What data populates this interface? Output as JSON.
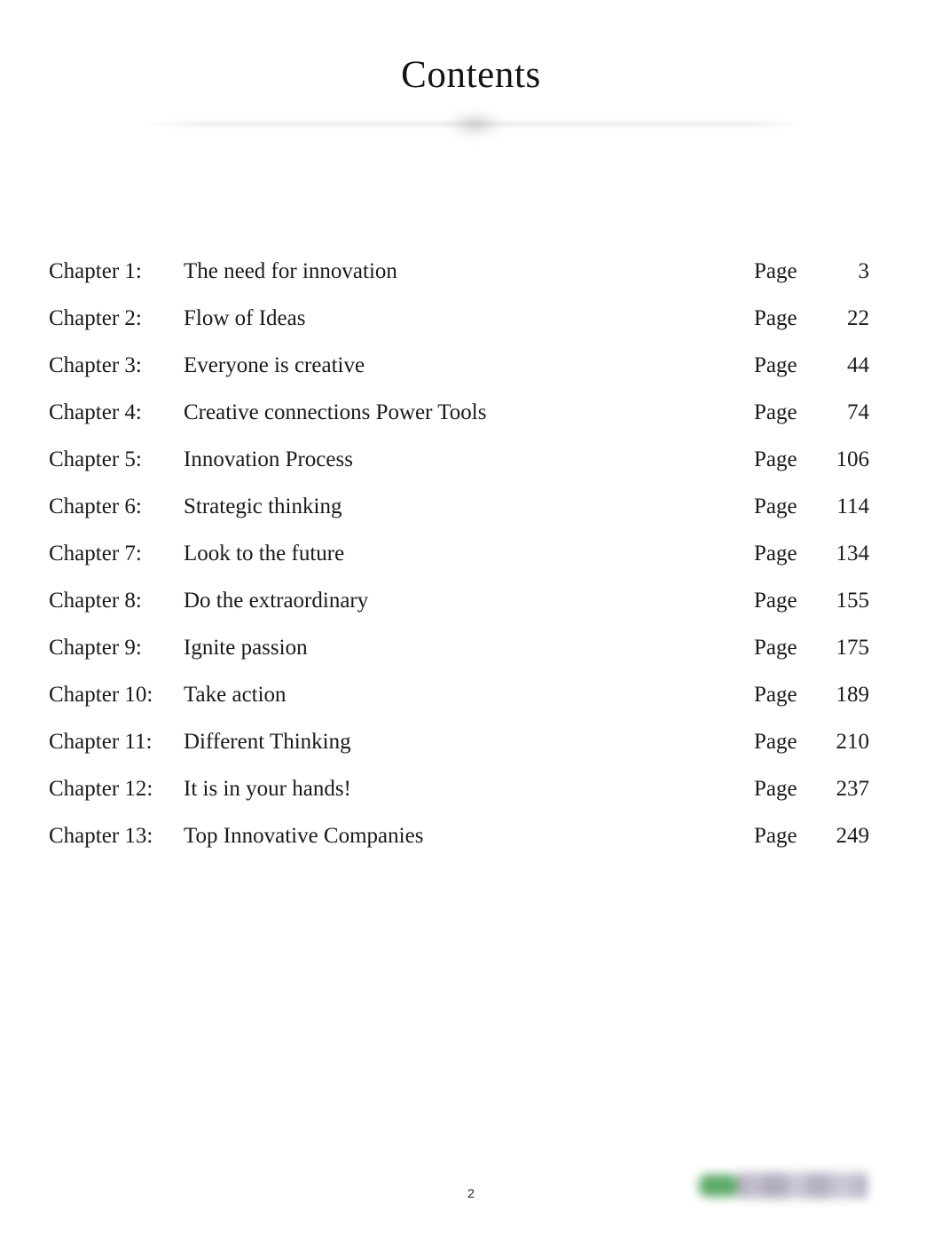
{
  "document": {
    "title": "Contents",
    "folio": "2",
    "text_color": "#1a1a1a",
    "background_color": "#ffffff"
  },
  "divider": {
    "ornament_icon": "flourish-ornament-icon",
    "rule_color": "#dcdce0"
  },
  "toc": {
    "page_label": "Page",
    "rows": [
      {
        "chapter": "Chapter 1:",
        "title": "The need for innovation",
        "page_label": "Page",
        "page": "3"
      },
      {
        "chapter": "Chapter 2:",
        "title": "Flow of Ideas",
        "page_label": "Page",
        "page": "22"
      },
      {
        "chapter": "Chapter 3:",
        "title": "Everyone is creative",
        "page_label": "Page",
        "page": "44"
      },
      {
        "chapter": "Chapter 4:",
        "title": "Creative connections Power Tools",
        "page_label": "Page",
        "page": "74"
      },
      {
        "chapter": "Chapter 5:",
        "title": "Innovation Process",
        "page_label": "Page",
        "page": "106"
      },
      {
        "chapter": "Chapter 6:",
        "title": "Strategic thinking",
        "page_label": "Page",
        "page": "114"
      },
      {
        "chapter": "Chapter 7:",
        "title": "Look to the future",
        "page_label": "Page",
        "page": "134"
      },
      {
        "chapter": "Chapter 8:",
        "title": "Do the extraordinary",
        "page_label": "Page",
        "page": "155"
      },
      {
        "chapter": "Chapter 9:",
        "title": "Ignite passion",
        "page_label": "Page",
        "page": "175"
      },
      {
        "chapter": "Chapter 10:",
        "title": "Take action",
        "page_label": "Page",
        "page": "189"
      },
      {
        "chapter": "Chapter 11:",
        "title": "Different Thinking",
        "page_label": "Page",
        "page": "210"
      },
      {
        "chapter": "Chapter 12:",
        "title": "It is in your hands!",
        "page_label": "Page",
        "page": "237"
      },
      {
        "chapter": "Chapter 13:",
        "title": "Top Innovative Companies",
        "page_label": "Page",
        "page": "249"
      }
    ]
  },
  "logo": {
    "icon": "publisher-logo-icon",
    "badge_color": "#4fa45c",
    "wordmark_color": "#968ea8"
  }
}
